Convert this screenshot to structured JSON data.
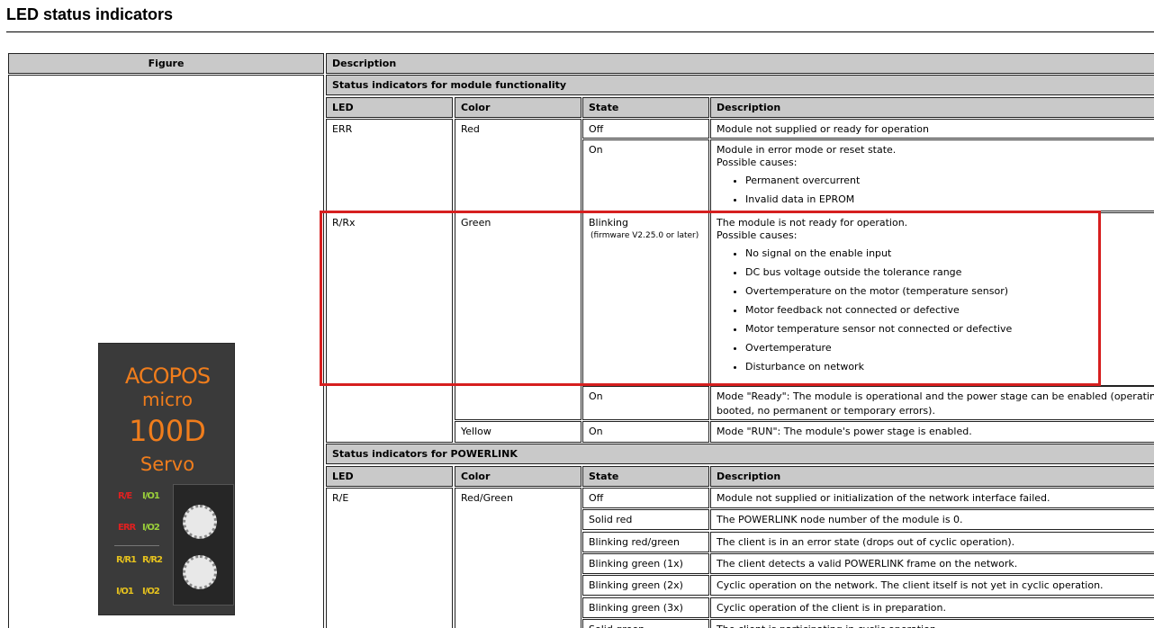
{
  "page": {
    "title": "LED status indicators"
  },
  "table": {
    "col_figure": "Figure",
    "col_description": "Description",
    "group1": {
      "title": "Status indicators for module functionality",
      "headers": {
        "led": "LED",
        "color": "Color",
        "state": "State",
        "description": "Description"
      },
      "err": {
        "led": "ERR",
        "color": "Red",
        "off_state": "Off",
        "off_desc": "Module not supplied or ready for operation",
        "on_state": "On",
        "on_desc": "Module in error mode or reset state.",
        "on_causes_label": "Possible causes:",
        "on_causes": [
          "Permanent overcurrent",
          "Invalid data in EPROM"
        ]
      },
      "rrx": {
        "led": "R/Rx",
        "color": "Green",
        "blink_state": "Blinking",
        "blink_sub": "(firmware V2.25.0 or later)",
        "blink_desc": "The module is not ready for operation.",
        "blink_causes_label": "Possible causes:",
        "blink_causes": [
          "No signal on the enable input",
          "DC bus voltage outside the tolerance range",
          "Overtemperature on the motor (temperature sensor)",
          "Motor feedback not connected or defective",
          "Motor temperature sensor not connected or defective",
          "Overtemperature",
          "Disturbance on network"
        ],
        "on_state": "On",
        "on_desc_line1": "Mode \"Ready\": The module is operational and the power stage can be enabled (operating s",
        "on_desc_line2": "booted, no permanent or temporary errors).",
        "yellow_color": "Yellow",
        "yellow_state": "On",
        "yellow_desc": "Mode \"RUN\": The module's power stage is enabled."
      }
    },
    "group2": {
      "title": "Status indicators for POWERLINK",
      "headers": {
        "led": "LED",
        "color": "Color",
        "state": "State",
        "description": "Description"
      },
      "led": "R/E",
      "color": "Red/Green",
      "rows": [
        {
          "state": "Off",
          "desc": "Module not supplied or initialization of the network interface failed."
        },
        {
          "state": "Solid red",
          "desc": "The POWERLINK node number of the module is 0."
        },
        {
          "state": "Blinking red/green",
          "desc": "The client is in an error state (drops out of cyclic operation)."
        },
        {
          "state": "Blinking green (1x)",
          "desc": "The client detects a valid POWERLINK frame on the network."
        },
        {
          "state": "Blinking green (2x)",
          "desc": "Cyclic operation on the network. The client itself is not yet in cyclic operation."
        },
        {
          "state": "Blinking green (3x)",
          "desc": "Cyclic operation of the client is in preparation."
        },
        {
          "state": "Solid green",
          "desc": "The client is participating in cyclic operation."
        }
      ]
    }
  },
  "figure": {
    "brand": "ACOPOS",
    "sub": "micro",
    "model": "100D",
    "type": "Servo",
    "leds": [
      "R/E",
      "I/O1",
      "ERR",
      "I/O2",
      "R/R1",
      "R/R2",
      "I/O1",
      "I/O2"
    ],
    "colors": {
      "orange": "#f07d1c",
      "red": "#e02020",
      "green": "#9bd13a",
      "yellow": "#e6c21e"
    }
  },
  "highlight": {
    "color": "#d61f1f"
  }
}
